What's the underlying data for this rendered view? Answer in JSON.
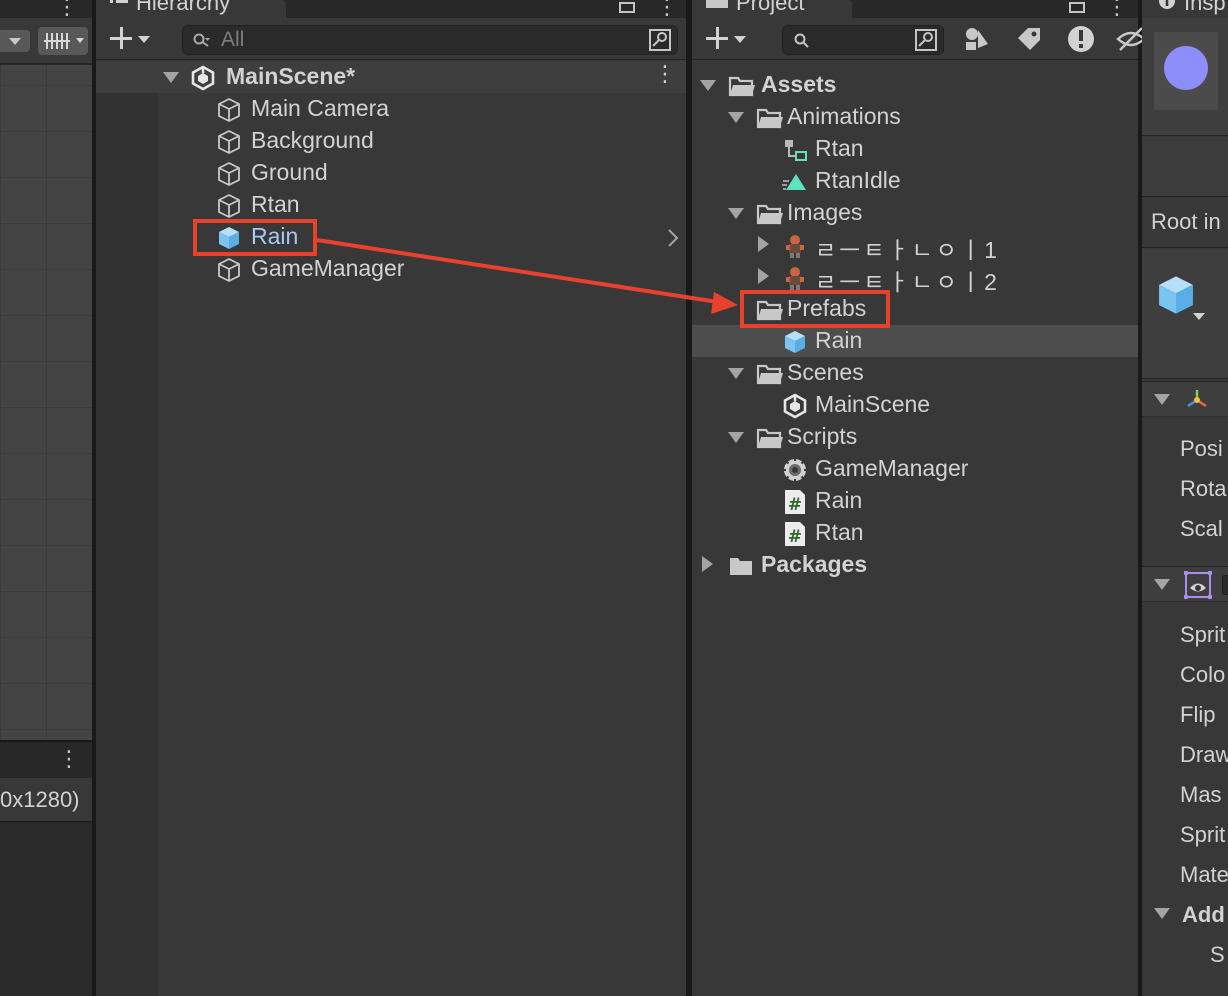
{
  "scene_panel": {
    "resolution_label": "0x1280)"
  },
  "hierarchy": {
    "tab_label": "Hierarchy",
    "search_placeholder": "All",
    "scene_name": "MainScene*",
    "items": [
      {
        "label": "Main Camera",
        "icon": "gameobject-cube-icon"
      },
      {
        "label": "Background",
        "icon": "gameobject-cube-icon"
      },
      {
        "label": "Ground",
        "icon": "gameobject-cube-icon"
      },
      {
        "label": "Rtan",
        "icon": "gameobject-cube-icon"
      },
      {
        "label": "Rain",
        "icon": "prefab-cube-icon",
        "selected_highlight": true
      },
      {
        "label": "GameManager",
        "icon": "gameobject-cube-icon"
      }
    ]
  },
  "project": {
    "tab_label": "Project",
    "search_placeholder": "",
    "tree": {
      "assets": "Assets",
      "animations": "Animations",
      "animations_rtan": "Rtan",
      "animations_rtanidle": "RtanIdle",
      "images": "Images",
      "image_1": "ㄹㅡㅌㅏㄴㅇㅣ1",
      "image_2": "ㄹㅡㅌㅏㄴㅇㅣ2",
      "prefabs": "Prefabs",
      "prefabs_rain": "Rain",
      "scenes": "Scenes",
      "scenes_mainscene": "MainScene",
      "scripts": "Scripts",
      "scripts_gamemanager": "GameManager",
      "scripts_rain": "Rain",
      "scripts_rtan": "Rtan",
      "packages": "Packages"
    }
  },
  "inspector": {
    "tab_label": "Insp",
    "root_label": "Root in",
    "transform_props": [
      "Posi",
      "Rota",
      "Scal"
    ],
    "sprite_props": [
      "Sprit",
      "Colo",
      "Flip",
      "Draw",
      "Mas",
      "Sprit",
      "Mate"
    ],
    "add_label": "Add",
    "sub_label": "S"
  },
  "colors": {
    "highlight": "#e8412e",
    "prefab_blue": "#8ccaf2",
    "selected_text": "#a6c8f4"
  }
}
